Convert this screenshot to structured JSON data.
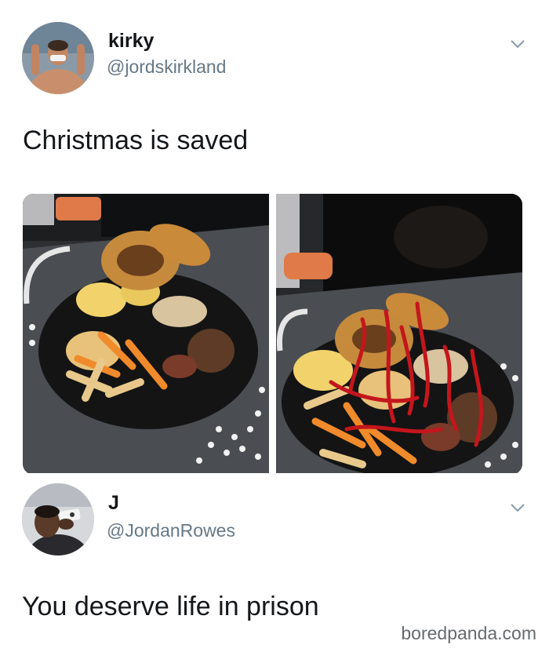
{
  "tweet1": {
    "display_name": "kirky",
    "handle": "@jordskirkland",
    "text": "Christmas is saved",
    "avatar_icon": "user-photo-shirtless",
    "menu_icon": "chevron-down-icon"
  },
  "tweet2": {
    "display_name": "J",
    "handle": "@JordanRowes",
    "text": "You deserve life in prison",
    "avatar_icon": "user-photo-selfie",
    "menu_icon": "chevron-down-icon"
  },
  "watermark": "boredpanda.com",
  "colors": {
    "text": "#14171a",
    "handle": "#657786",
    "ketchup": "#c4161c",
    "plate": "#141414"
  }
}
